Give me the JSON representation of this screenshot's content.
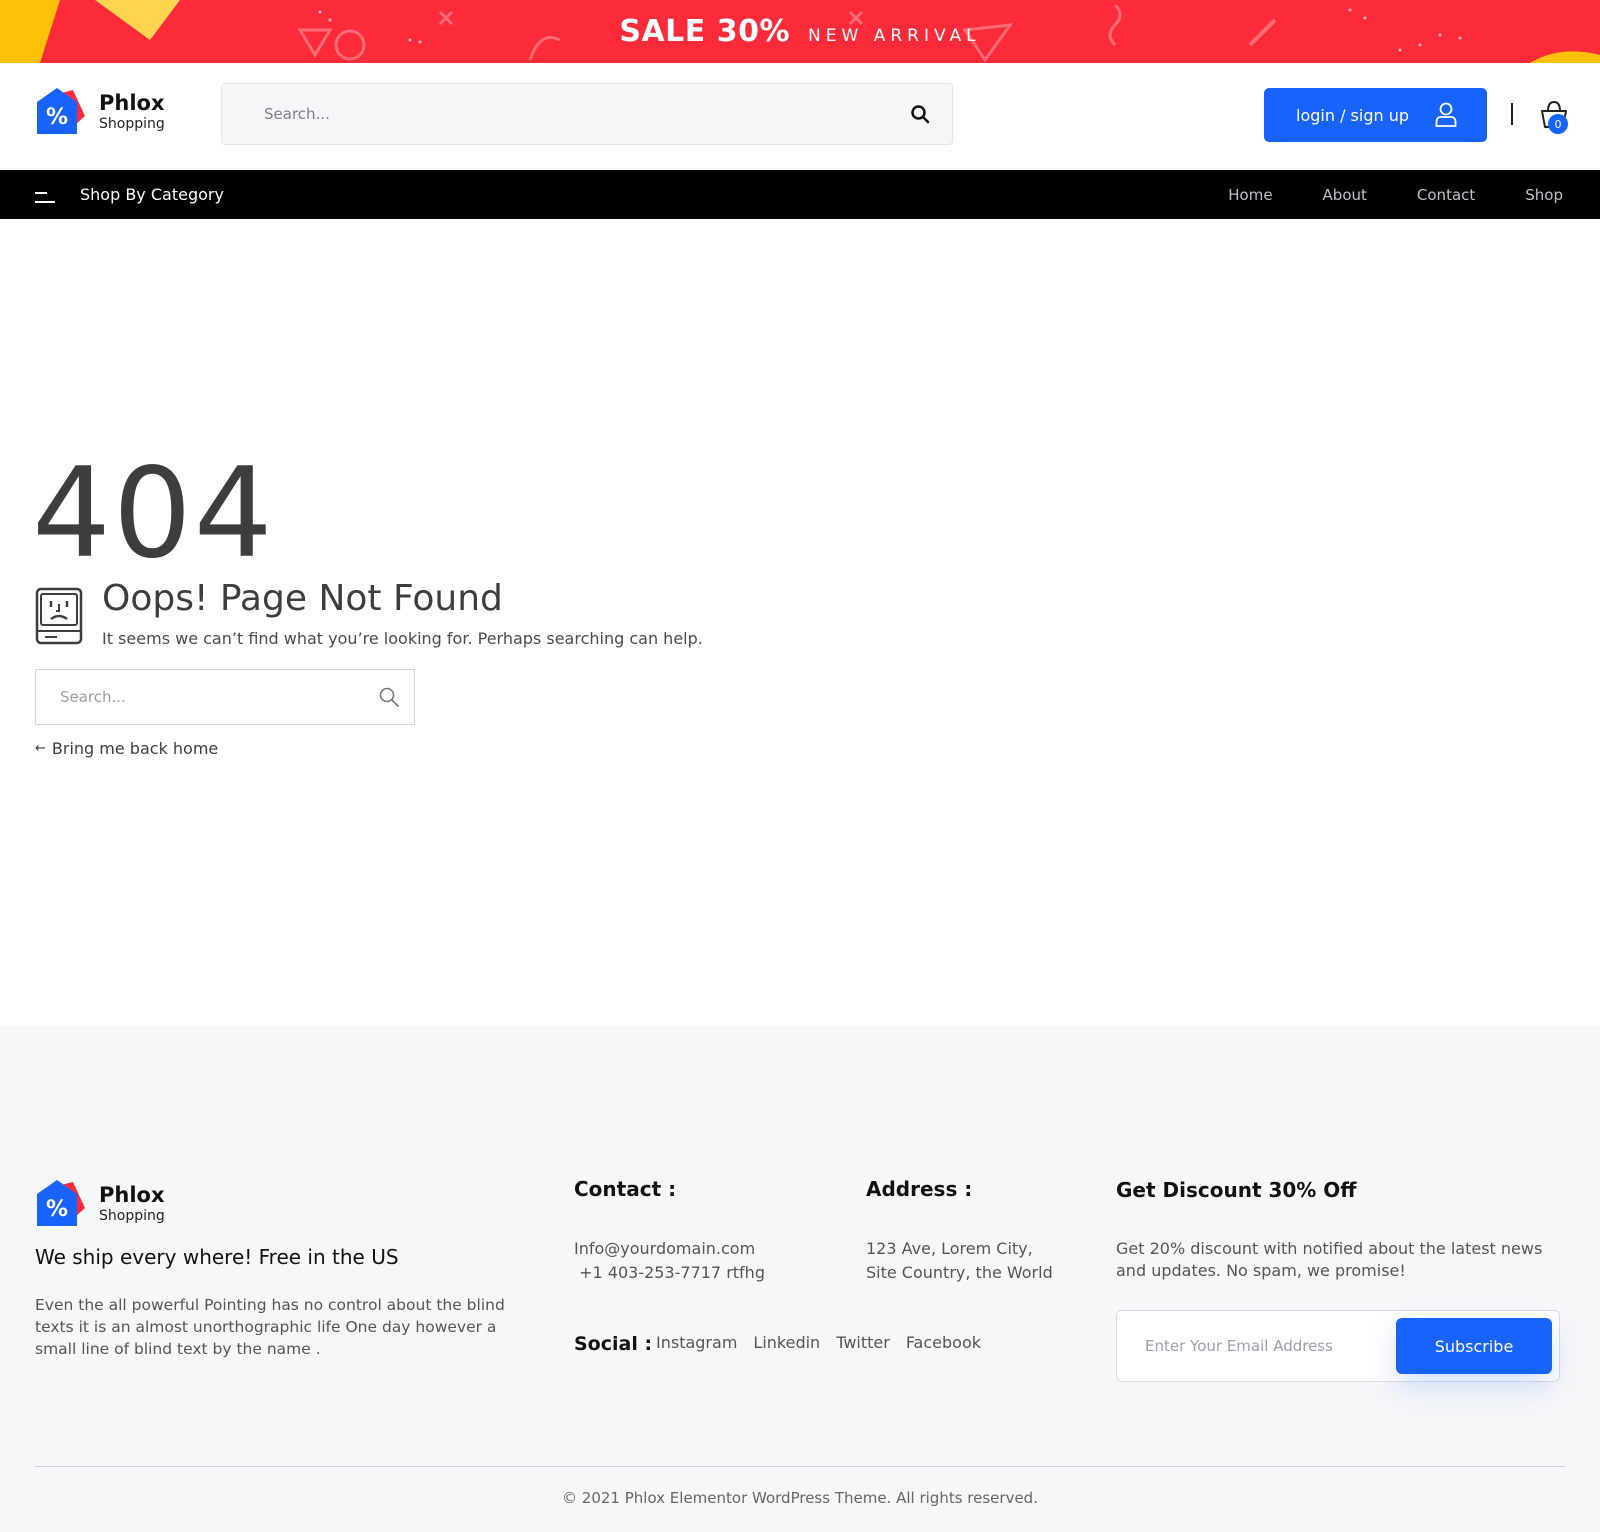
{
  "promo": {
    "sale": "SALE 30%",
    "sub": "NEW ARRIVAL"
  },
  "brand": {
    "name": "Phlox",
    "sub": "Shopping"
  },
  "header": {
    "search_placeholder": "Search...",
    "login_label": "login / sign up",
    "cart_count": "0"
  },
  "nav": {
    "category_label": "Shop By Category",
    "links": [
      "Home",
      "About",
      "Contact",
      "Shop"
    ]
  },
  "error": {
    "code": "404",
    "title": "Oops! Page Not Found",
    "message": "It seems we can’t find what you’re looking for. Perhaps searching can help.",
    "search_placeholder": "Search...",
    "back_arrow": "←",
    "back_label": "Bring me back home"
  },
  "footer": {
    "tagline": "We ship every where! Free in the US",
    "description": "Even the all powerful Pointing has no control about the blind texts it is an almost unorthographic life One day however a small line of blind text by the name .",
    "contact": {
      "heading": "Contact :",
      "email": "Info@yourdomain.com",
      "phone": " +1 403-253-7717 rtfhg"
    },
    "address": {
      "heading": "Address :",
      "line1": "123 Ave, Lorem City,",
      "line2": "Site Country, the World"
    },
    "social": {
      "label": "Social :",
      "links": [
        "Instagram",
        "Linkedin",
        "Twitter",
        "Facebook"
      ]
    },
    "discount": {
      "heading": "Get Discount 30% Off",
      "text": "Get 20% discount with notified about the latest news and updates. No spam, we promise!",
      "email_placeholder": "Enter Your Email Address",
      "button": "Subscribe"
    },
    "copyright": "© 2021 Phlox Elementor WordPress Theme. All rights reserved."
  },
  "colors": {
    "promo_red": "#fb2b3a",
    "accent_blue": "#1863fb",
    "nav_black": "#000000",
    "footer_bg": "#f6f7f9"
  }
}
